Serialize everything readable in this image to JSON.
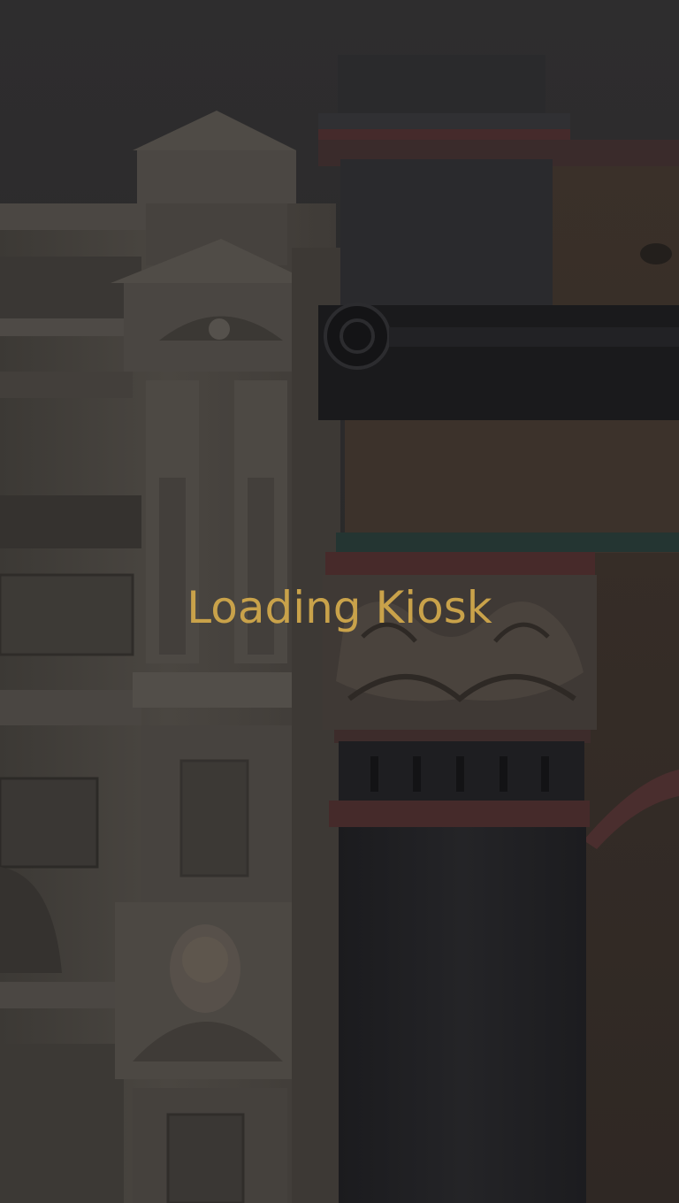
{
  "kiosk": {
    "loading_text": "Loading Kiosk"
  },
  "background": {
    "subject": "ornate-building-facade-photo"
  },
  "colors": {
    "accent_gold": "#c9a24a",
    "sky": "#2b2a2b",
    "facade_light": "#4a4642",
    "facade_dark_pillar": "#1e1e21",
    "facade_warm": "#3a322c",
    "trim_red": "#4a2a2a",
    "trim_teal": "#233431"
  }
}
